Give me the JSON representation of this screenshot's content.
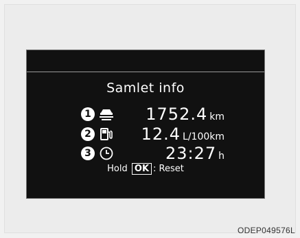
{
  "display": {
    "title": "Samlet info",
    "rows": [
      {
        "index": "1",
        "icon": "car-distance-icon",
        "value": "1752.4",
        "unit": "km"
      },
      {
        "index": "2",
        "icon": "fuel-pump-icon",
        "value": "12.4",
        "unit": "L/100km"
      },
      {
        "index": "3",
        "icon": "clock-icon",
        "value": "23:27",
        "unit": "h"
      }
    ],
    "hint": {
      "prefix": "Hold",
      "button": "OK",
      "suffix": ": Reset"
    }
  },
  "figure_code": "ODEP049576L"
}
